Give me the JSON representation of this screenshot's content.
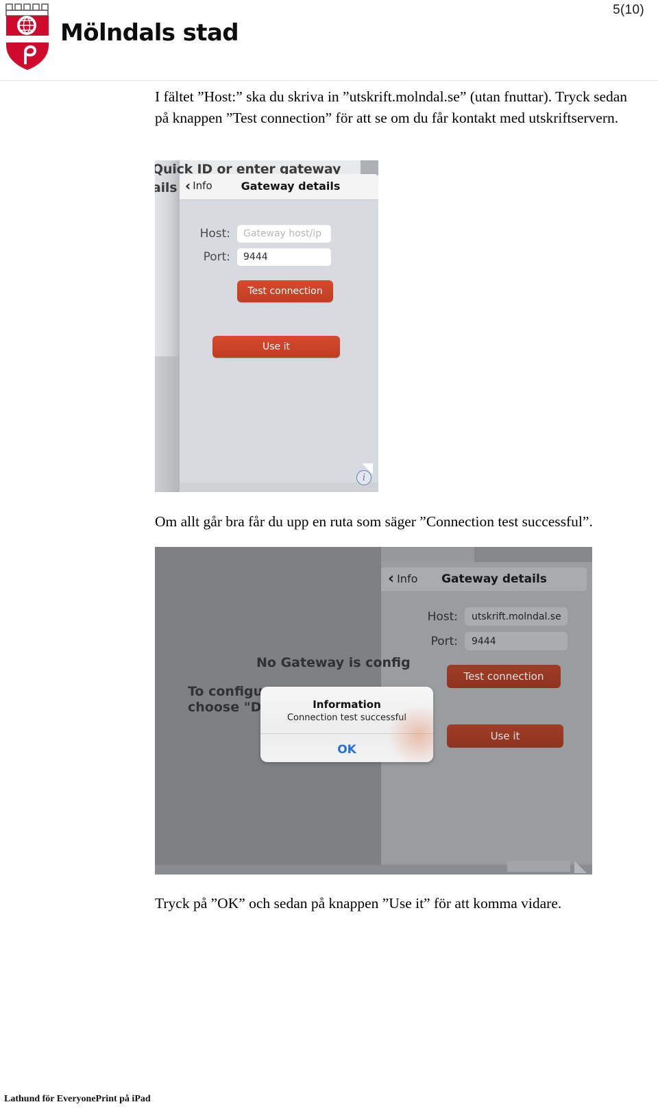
{
  "header": {
    "page_number": "5(10)",
    "logo_text": "Mölndals stad",
    "logo_colors": {
      "shield_red": "#cf0a2c",
      "shield_white": "#ffffff",
      "crown_gray": "#6b6b6b"
    }
  },
  "body": {
    "paragraph_intro": "I fältet ”Host:” ska du skriva in ”utskrift.molndal.se” (utan fnuttar). Tryck sedan på knappen ”Test connection” för att se om du får kontakt med utskriftservern.",
    "paragraph_middle": "Om allt går bra får du upp en ruta som säger ”Connection test successful”.",
    "paragraph_end": "Tryck på ”OK” och sedan på knappen ”Use it” för att komma vidare."
  },
  "screenshot_one": {
    "background_text_line1": "Quick ID or enter gateway",
    "background_text_line2": "ails n",
    "nav": {
      "back_label": "Info",
      "title": "Gateway details",
      "chevron": "‹"
    },
    "fields": [
      {
        "label": "Host:",
        "value": "",
        "placeholder": "Gateway host/ip"
      },
      {
        "label": "Port:",
        "value": "9444",
        "placeholder": ""
      }
    ],
    "buttons": [
      {
        "label": "Test connection",
        "color": "#c8401f"
      },
      {
        "label": "Use it",
        "color": "#c8401f"
      }
    ],
    "info_badge": "i"
  },
  "screenshot_two": {
    "background_text": {
      "line_no_gateway": "No Gateway is config",
      "line_configure_1": "To configure",
      "line_configure_2": "choose \"Dis"
    },
    "nav": {
      "back_label": "Info",
      "title": "Gateway details",
      "chevron": "‹"
    },
    "fields": [
      {
        "label": "Host:",
        "value": "utskrift.molndal.se"
      },
      {
        "label": "Port:",
        "value": "9444"
      }
    ],
    "buttons": [
      {
        "label": "Test connection",
        "color": "#9b3a24"
      },
      {
        "label": "Use it",
        "color": "#9b3a24"
      }
    ],
    "alert": {
      "title": "Information",
      "message": "Connection test successful",
      "ok_label": "OK",
      "ok_color": "#2a6fd6"
    }
  },
  "footer": {
    "text": "Lathund för EveryonePrint på iPad"
  }
}
